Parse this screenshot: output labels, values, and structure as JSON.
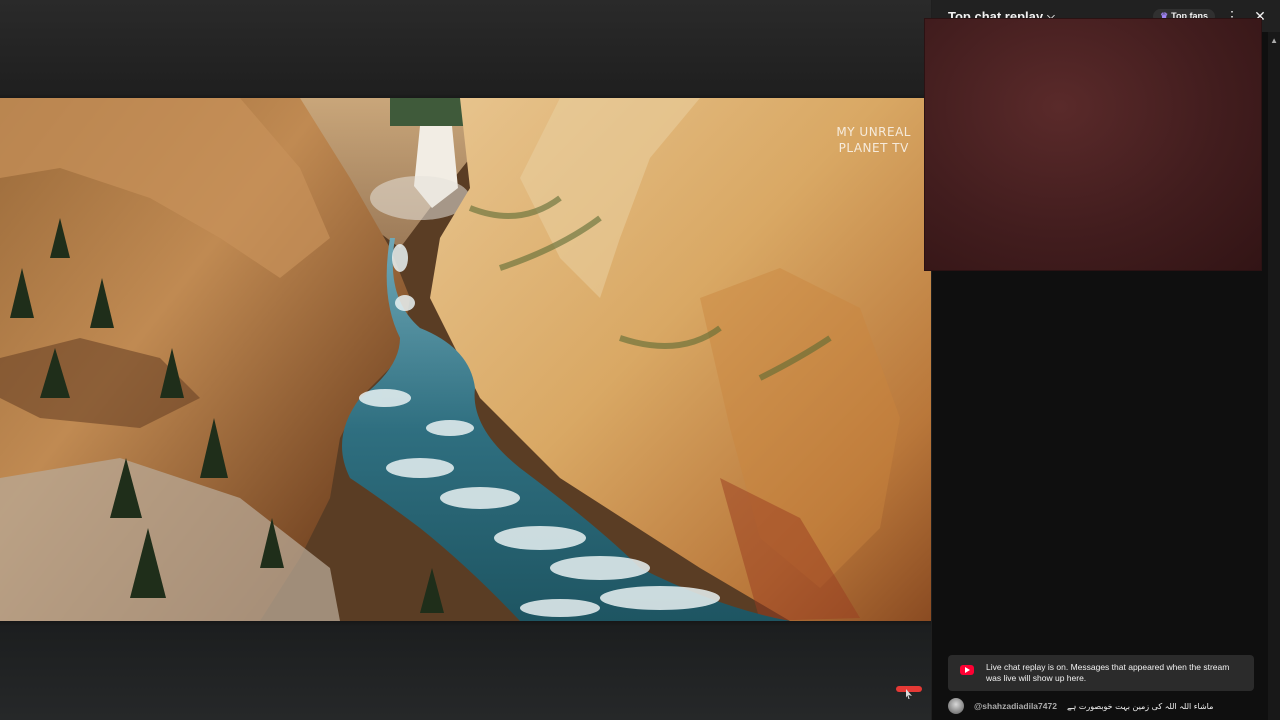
{
  "video": {
    "watermark_line1": "MY UNREAL",
    "watermark_line2": "PLANET TV",
    "scene": "canyon-river-waterfall"
  },
  "chat": {
    "title": "Top chat replay",
    "top_fans_label": "Top fans",
    "notice": "Live chat replay is on. Messages that appeared when the stream was live will show up here.",
    "messages": [
      {
        "author": "@shahzadiadila7472",
        "text": "ماشاء اللہ اللہ کی زمین بہت خوبصورت ہے"
      }
    ]
  },
  "colors": {
    "chat_bg": "#0f0f0f",
    "header_bg": "#212121",
    "overlay_bg": "#421d1e",
    "notice_bg": "#2b2b2b",
    "yt_red": "#ff0033",
    "crown": "#a084f5"
  },
  "icons": {
    "title_dropdown": "chevron-down-icon",
    "top_fans": "crown-icon",
    "more": "more-vert-icon",
    "close": "close-icon",
    "notice": "youtube-logo-icon"
  }
}
